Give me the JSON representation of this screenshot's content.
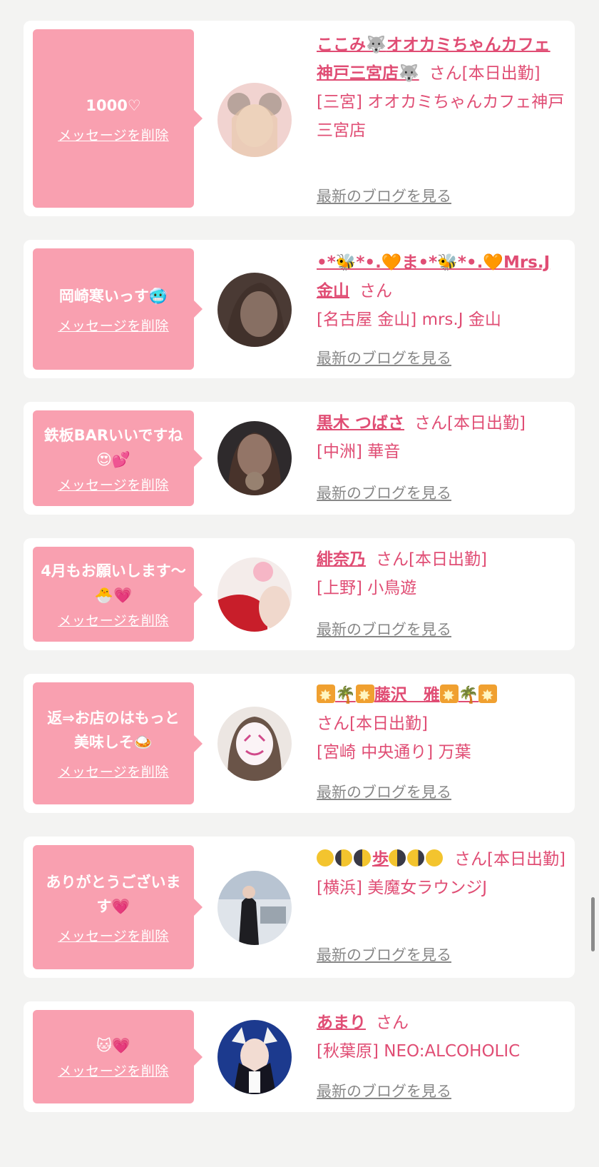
{
  "delete_label": "メッセージを削除",
  "san": "さん",
  "blog_label": "最新のブログを見る",
  "cards": [
    {
      "message": "1000♡",
      "name_prefix": "ここみ",
      "name": "オオカミちゃんカフェ神戸三宮店",
      "status": "[本日出勤]",
      "shop": "[三宮] オオカミちゃんカフェ神戸三宮店"
    },
    {
      "message": "岡崎寒いっす🥶",
      "name": "•*🐝*•.🧡ま•*🐝*•.🧡Mrs.J金山",
      "status": "",
      "shop": "[名古屋 金山] mrs.J 金山"
    },
    {
      "message": "鉄板BARいいですね😍💕",
      "name": "黒木 つばさ",
      "status": "[本日出勤]",
      "shop": "[中洲] 華音"
    },
    {
      "message": "4月もお願いします〜🐣💗",
      "name": "緋奈乃",
      "status": "[本日出勤]",
      "shop": "[上野] 小鳥遊"
    },
    {
      "message": "返⇒お店のはもっと美味しそ🍛",
      "name": "藤沢　雅",
      "status": "[本日出勤]",
      "shop": "[宮崎 中央通り] 万葉"
    },
    {
      "message": "ありがとうございます💗",
      "name": "歩",
      "status": "[本日出勤]",
      "shop": "[横浜] 美魔女ラウンジJ"
    },
    {
      "message": "🐱💗",
      "name": "あまり",
      "status": "",
      "shop": "[秋葉原] NEO:ALCOHOLIC"
    }
  ]
}
